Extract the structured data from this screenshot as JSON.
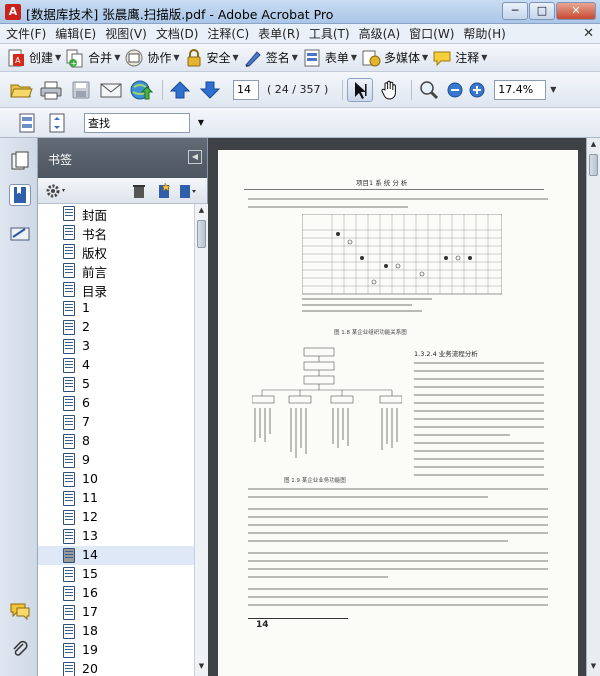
{
  "window": {
    "title": "[数据库技术] 张晨鹰.扫描版.pdf - Adobe Acrobat Pro",
    "minimize_label": "─",
    "maximize_label": "□",
    "close_label": "✕"
  },
  "menu": {
    "items": [
      "文件(F)",
      "编辑(E)",
      "视图(V)",
      "文档(D)",
      "注释(C)",
      "表单(R)",
      "工具(T)",
      "高级(A)",
      "窗口(W)",
      "帮助(H)"
    ],
    "close_label": "✕"
  },
  "toolbar": {
    "create_label": "创建",
    "combine_label": "合并",
    "collaborate_label": "协作",
    "secure_label": "安全",
    "sign_label": "签名",
    "forms_label": "表单",
    "multimedia_label": "多媒体",
    "comment_label": "注释"
  },
  "navigation": {
    "page_value": "14",
    "page_count": "( 24 / 357 )",
    "zoom_value": "17.4%"
  },
  "search": {
    "value": "查找"
  },
  "bookmarks": {
    "title": "书签",
    "items": [
      "封面",
      "书名",
      "版权",
      "前言",
      "目录",
      "1",
      "2",
      "3",
      "4",
      "5",
      "6",
      "7",
      "8",
      "9",
      "10",
      "11",
      "12",
      "13",
      "14",
      "15",
      "16",
      "17",
      "18",
      "19",
      "20"
    ],
    "selected_index": 18
  },
  "document": {
    "header": "项目1 系 统 分 析",
    "section": "1.3.2.4 业务流程分析",
    "fig1_caption": "图 1.8 某企业组织功能关系图",
    "fig2_caption": "图 1.9 某企业业务功能图",
    "page_number": "14"
  },
  "colors": {
    "accent": "#1f56b8",
    "panel_header": "#58606b",
    "doc_background": "#3e4146"
  }
}
